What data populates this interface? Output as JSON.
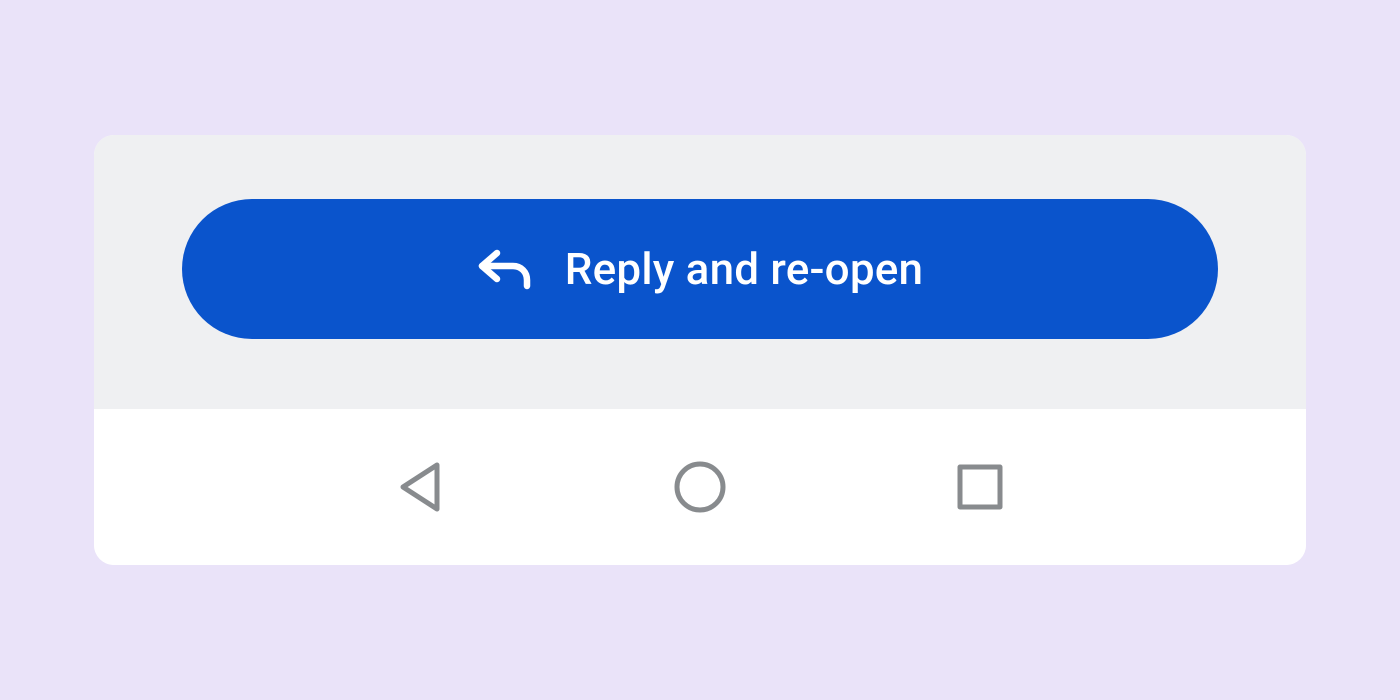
{
  "button": {
    "label": "Reply and re-open",
    "icon": "reply-arrow-icon"
  },
  "nav": {
    "back_icon": "triangle-back-icon",
    "home_icon": "circle-home-icon",
    "recent_icon": "square-recent-icon"
  },
  "colors": {
    "page_bg": "#EAE3F9",
    "panel_bg": "#EFF0F2",
    "button_bg": "#0A54CC",
    "button_fg": "#FFFFFF",
    "nav_icon": "#888B8E"
  }
}
